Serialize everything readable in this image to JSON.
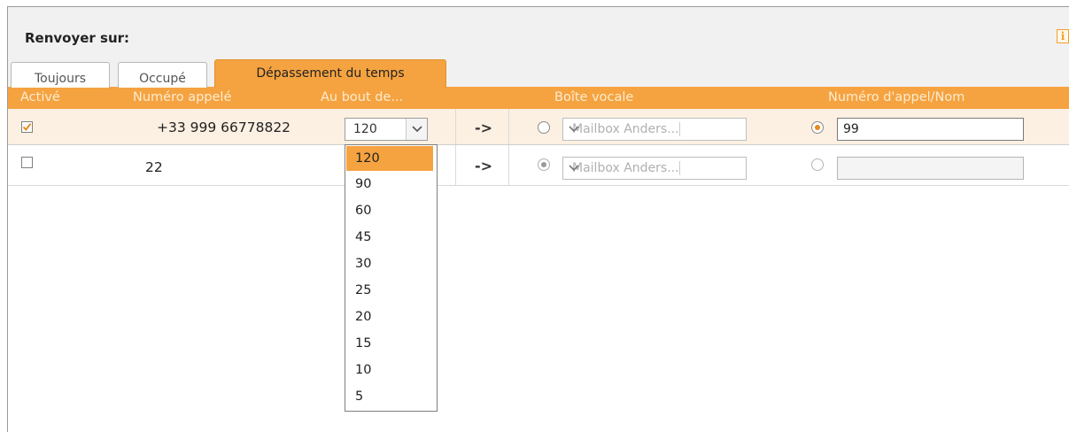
{
  "title": "Renvoyer sur:",
  "info_icon_char": "i",
  "tabs": [
    {
      "label": "Toujours",
      "active": false
    },
    {
      "label": "Occupé",
      "active": false
    },
    {
      "label": "Dépassement du temps",
      "active": true
    }
  ],
  "columns": {
    "active": "Activé",
    "called_number": "Numéro appelé",
    "after": "Au bout de...",
    "voicemail": "Boîte vocale",
    "call_number": "Numéro d'appel/Nom"
  },
  "rows": [
    {
      "checked": true,
      "called_number": "+33 999 66778822",
      "after_value": "120",
      "arrow": "->",
      "voicemail_selected": false,
      "mailbox_value": "Mailbox Anders...",
      "number_selected": true,
      "number_value": "99"
    },
    {
      "checked": false,
      "called_number": "22",
      "after_value": "",
      "arrow": "->",
      "voicemail_selected": true,
      "mailbox_value": "Mailbox Anders...",
      "number_selected": false,
      "number_value": ""
    }
  ],
  "dropdown_options": [
    "120",
    "90",
    "60",
    "45",
    "30",
    "25",
    "20",
    "15",
    "10",
    "5"
  ],
  "dropdown_selected": "120",
  "colors": {
    "accent": "#f5a340",
    "row_highlight": "#fcf0e2",
    "header_text": "#fdebd0"
  },
  "icons": {
    "info": "info-icon",
    "check": "checkmark-icon",
    "chevron": "chevron-down-icon",
    "arrow": "right-arrow-icon"
  }
}
